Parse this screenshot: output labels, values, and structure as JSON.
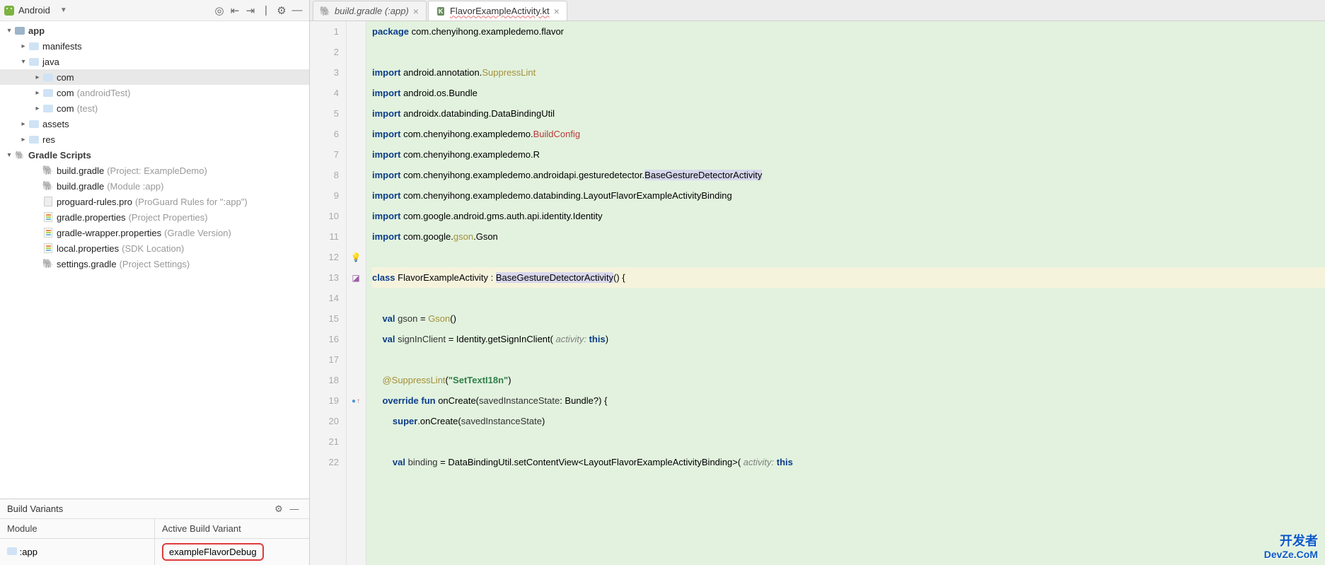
{
  "treeBar": {
    "label": "Android"
  },
  "tree": {
    "root": "app",
    "items": [
      {
        "depth": 1,
        "arrow": "right",
        "ico": "folder",
        "name": "manifests"
      },
      {
        "depth": 1,
        "arrow": "down",
        "ico": "folder",
        "name": "java"
      },
      {
        "depth": 2,
        "arrow": "right",
        "ico": "folder",
        "name": "com",
        "selected": true
      },
      {
        "depth": 2,
        "arrow": "right",
        "ico": "folder",
        "name": "com",
        "note": "(androidTest)"
      },
      {
        "depth": 2,
        "arrow": "right",
        "ico": "folder",
        "name": "com",
        "note": "(test)"
      },
      {
        "depth": 1,
        "arrow": "right",
        "ico": "folder",
        "name": "assets"
      },
      {
        "depth": 1,
        "arrow": "right",
        "ico": "folder",
        "name": "res"
      }
    ],
    "gradleLabel": "Gradle Scripts",
    "gradleItems": [
      {
        "ico": "gradle",
        "name": "build.gradle",
        "note": "(Project: ExampleDemo)"
      },
      {
        "ico": "gradle",
        "name": "build.gradle",
        "note": "(Module :app)"
      },
      {
        "ico": "file",
        "name": "proguard-rules.pro",
        "note": "(ProGuard Rules for \":app\")"
      },
      {
        "ico": "prop",
        "name": "gradle.properties",
        "note": "(Project Properties)"
      },
      {
        "ico": "prop",
        "name": "gradle-wrapper.properties",
        "note": "(Gradle Version)"
      },
      {
        "ico": "prop",
        "name": "local.properties",
        "note": "(SDK Location)"
      },
      {
        "ico": "gradle",
        "name": "settings.gradle",
        "note": "(Project Settings)"
      }
    ]
  },
  "buildVariants": {
    "title": "Build Variants",
    "colModule": "Module",
    "colVariant": "Active Build Variant",
    "module": ":app",
    "variant": "exampleFlavorDebug"
  },
  "tabs": [
    {
      "label": "build.gradle (:app)",
      "ico": "gradle"
    },
    {
      "label": "FlavorExampleActivity.kt",
      "ico": "kt",
      "active": true
    }
  ],
  "code": {
    "lines": [
      {
        "n": 1,
        "html": "<span class='kw'>package</span> com.chenyihong.exampledemo.flavor"
      },
      {
        "n": 2,
        "html": ""
      },
      {
        "n": 3,
        "html": "<span class='kw'>import</span> android.annotation.<span class='ann'>SuppressLint</span>"
      },
      {
        "n": 4,
        "html": "<span class='kw'>import</span> android.os.Bundle"
      },
      {
        "n": 5,
        "html": "<span class='kw'>import</span> androidx.databinding.DataBindingUtil"
      },
      {
        "n": 6,
        "html": "<span class='kw'>import</span> com.chenyihong.exampledemo.<span class='imp-red'>BuildConfig</span>"
      },
      {
        "n": 7,
        "html": "<span class='kw'>import</span> com.chenyihong.exampledemo.R"
      },
      {
        "n": 8,
        "html": "<span class='kw'>import</span> com.chenyihong.exampledemo.androidapi.gesturedetector.<span class='ref-hi'>BaseGestureDetectorActivity</span>"
      },
      {
        "n": 9,
        "html": "<span class='kw'>import</span> com.chenyihong.exampledemo.databinding.LayoutFlavorExampleActivityBinding"
      },
      {
        "n": 10,
        "html": "<span class='kw'>import</span> com.google.android.gms.auth.api.identity.Identity"
      },
      {
        "n": 11,
        "html": "<span class='kw'>import</span> com.google.<span class='imp-warn'>gson</span>.Gson"
      },
      {
        "n": 12,
        "html": ""
      },
      {
        "n": 13,
        "html": "<span class='kw'>class</span> FlavorExampleActivity : <span class='ref-hi'>BaseGestureDetectorActivity</span>() {",
        "curr": true
      },
      {
        "n": 14,
        "html": ""
      },
      {
        "n": 15,
        "html": "    <span class='kw'>val</span> <span class='fn'>gson</span> = <span class='imp-warn'>Gson</span>()"
      },
      {
        "n": 16,
        "html": "    <span class='kw'>val</span> <span class='fn'>signInClient</span> = Identity.getSignInClient( <span class='pname'>activity:</span> <span class='kw'>this</span>)"
      },
      {
        "n": 17,
        "html": ""
      },
      {
        "n": 18,
        "html": "    <span class='ann'>@SuppressLint</span>(<span class='str'>\"SetTextI18n\"</span>)"
      },
      {
        "n": 19,
        "html": "    <span class='kw'>override fun</span> onCreate(<span class='fn'>savedInstanceState</span>: Bundle?) {"
      },
      {
        "n": 20,
        "html": "        <span class='kw'>super</span>.onCreate(<span class='fn'>savedInstanceState</span>)"
      },
      {
        "n": 21,
        "html": ""
      },
      {
        "n": 22,
        "html": "        <span class='kw'>val</span> <span class='fn'>binding</span> = DataBindingUtil.setContentView&lt;LayoutFlavorExampleActivityBinding&gt;( <span class='pname'>activity:</span> <span class='kw'>this</span>"
      }
    ]
  },
  "watermark": {
    "line1": "开发者",
    "line2": "DevZe.CoM"
  }
}
